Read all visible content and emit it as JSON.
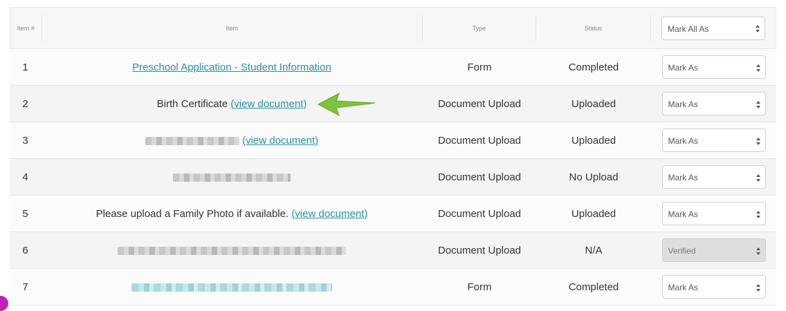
{
  "header": {
    "item_num": "Item #",
    "item": "Item",
    "type": "Type",
    "status": "Status",
    "mark_all": "Mark All As"
  },
  "rows": [
    {
      "num": "1",
      "item_link": "Preschool Application - Student Information",
      "type": "Form",
      "status": "Completed",
      "mark": "Mark As"
    },
    {
      "num": "2",
      "item_text": "Birth Certificate ",
      "item_link": "(view document)",
      "type": "Document Upload",
      "status": "Uploaded",
      "mark": "Mark As"
    },
    {
      "num": "3",
      "item_link": "(view document)",
      "type": "Document Upload",
      "status": "Uploaded",
      "mark": "Mark As"
    },
    {
      "num": "4",
      "type": "Document Upload",
      "status": "No Upload",
      "mark": "Mark As"
    },
    {
      "num": "5",
      "item_text": "Please upload a Family Photo if available. ",
      "item_link": "(view document)",
      "type": "Document Upload",
      "status": "Uploaded",
      "mark": "Mark As"
    },
    {
      "num": "6",
      "type": "Document Upload",
      "status": "N/A",
      "mark": "Verified"
    },
    {
      "num": "7",
      "type": "Form",
      "status": "Completed",
      "mark": "Mark As"
    }
  ],
  "colors": {
    "link": "#2a8fa6",
    "arrow": "#7cc43b"
  }
}
